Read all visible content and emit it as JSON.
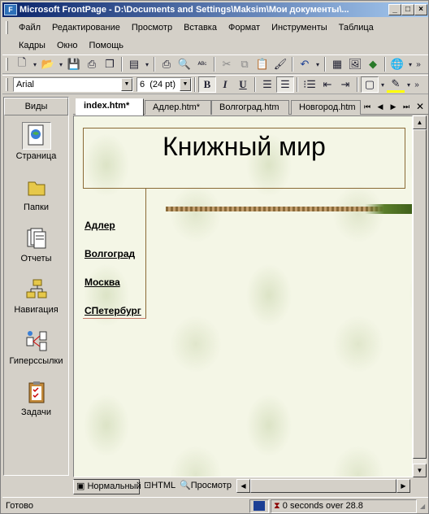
{
  "window": {
    "app_icon": "frontpage-app-icon",
    "title": "Microsoft FrontPage - D:\\Documents and Settings\\Maksim\\Мои документы\\..."
  },
  "menu": [
    "Файл",
    "Редактирование",
    "Просмотр",
    "Вставка",
    "Формат",
    "Инструменты",
    "Таблица",
    "Кадры",
    "Окно",
    "Помощь"
  ],
  "toolbar_standard": {
    "icons": [
      "new-page-icon",
      "open-icon",
      "save-icon",
      "publish-icon",
      "folder-list-icon",
      "views-bar-icon",
      "print-icon",
      "print-preview-icon",
      "spelling-icon",
      "cut-icon",
      "copy-icon",
      "paste-icon",
      "format-painter-icon",
      "undo-icon",
      "insert-table-icon",
      "insert-picture-icon",
      "insert-drawing-icon",
      "hyperlink-icon"
    ]
  },
  "toolbar_formatting": {
    "font": "Arial",
    "size": "6  (24 pt)",
    "bold_label": "B",
    "italic_label": "I",
    "underline_label": "U",
    "icons": [
      "align-left-icon",
      "align-center-icon",
      "numbered-list-icon",
      "bulleted-list-icon",
      "decrease-indent-icon",
      "increase-indent-icon",
      "border-icon",
      "highlight-icon",
      "font-color-icon"
    ]
  },
  "colors": {
    "titlebar_start": "#0a246a",
    "titlebar_end": "#a6caf0",
    "page_border": "#8a6a36",
    "page_background": "#f4f6e6"
  },
  "views_bar": {
    "header": "Виды",
    "items": [
      {
        "label": "Страница",
        "icon": "page-view-icon",
        "active": true
      },
      {
        "label": "Папки",
        "icon": "folders-icon",
        "active": false
      },
      {
        "label": "Отчеты",
        "icon": "reports-icon",
        "active": false
      },
      {
        "label": "Навигация",
        "icon": "navigation-icon",
        "active": false
      },
      {
        "label": "Гиперссылки",
        "icon": "hyperlinks-icon",
        "active": false
      },
      {
        "label": "Задачи",
        "icon": "tasks-icon",
        "active": false
      }
    ]
  },
  "doc_tabs": [
    "index.htm*",
    "Адлер.htm*",
    "Волгоград.htm",
    "Новгород.htm"
  ],
  "page": {
    "heading": "Книжный мир",
    "nav_links": [
      "Адлер",
      "Волгоград",
      "Москва",
      "СПетербург"
    ]
  },
  "view_tabs": [
    "Нормальный",
    "HTML",
    "Просмотр"
  ],
  "status": {
    "left": "Готово",
    "timing": "0 seconds over 28.8"
  }
}
